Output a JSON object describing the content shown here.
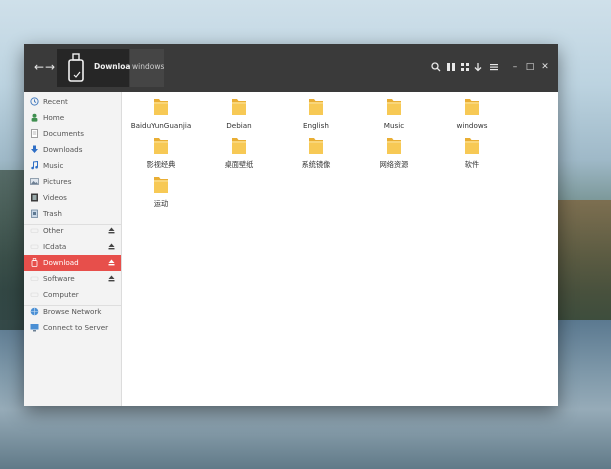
{
  "header": {
    "back_glyph": "←",
    "forward_glyph": "→",
    "path_current": "Download",
    "path_next": "windows",
    "minimize_glyph": "–",
    "maximize_glyph": "□",
    "close_glyph": "✕"
  },
  "sidebar": {
    "items": [
      {
        "label": "Recent",
        "icon": "recent-icon"
      },
      {
        "label": "Home",
        "icon": "home-icon"
      },
      {
        "label": "Documents",
        "icon": "documents-icon"
      },
      {
        "label": "Downloads",
        "icon": "downloads-icon"
      },
      {
        "label": "Music",
        "icon": "music-icon"
      },
      {
        "label": "Pictures",
        "icon": "pictures-icon"
      },
      {
        "label": "Videos",
        "icon": "videos-icon"
      },
      {
        "label": "Trash",
        "icon": "trash-icon"
      },
      {
        "label": "Other",
        "icon": "drive-icon"
      },
      {
        "label": "ICdata",
        "icon": "drive-icon"
      },
      {
        "label": "Download",
        "icon": "usb-icon"
      },
      {
        "label": "Software",
        "icon": "drive-icon"
      },
      {
        "label": "Computer",
        "icon": "computer-icon"
      },
      {
        "label": "Browse Network",
        "icon": "network-icon"
      },
      {
        "label": "Connect to Server",
        "icon": "server-icon"
      }
    ]
  },
  "folders": [
    "BaiduYunGuanjia",
    "Debian",
    "English",
    "Music",
    "windows",
    "影视经典",
    "桌面壁纸",
    "系统镜像",
    "网络资源",
    "软件",
    "运动"
  ],
  "colors": {
    "accent": "#e74f4b",
    "folder": "#f5c14a",
    "headerbar": "#3a3a3a"
  }
}
